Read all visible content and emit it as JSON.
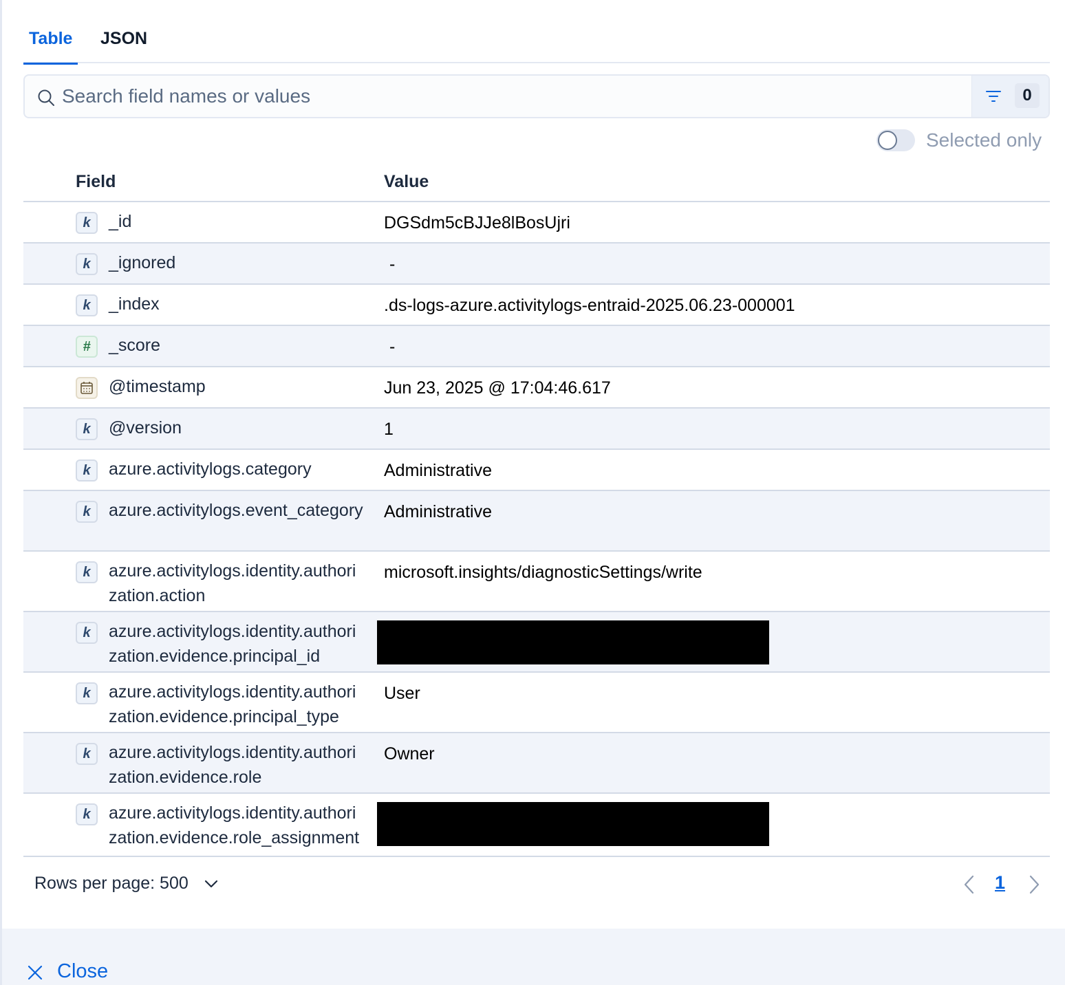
{
  "tabs": [
    {
      "label": "Table",
      "active": true
    },
    {
      "label": "JSON",
      "active": false
    }
  ],
  "search": {
    "placeholder": "Search field names or values",
    "value": "",
    "filter_count": "0"
  },
  "selected_only": {
    "label": "Selected only",
    "checked": false
  },
  "table": {
    "headers": {
      "field": "Field",
      "value": "Value"
    },
    "rows": [
      {
        "type": "k",
        "field": "_id",
        "value": "DGSdm5cBJJe8lBosUjri"
      },
      {
        "type": "k",
        "field": "_ignored",
        "value": "-"
      },
      {
        "type": "k",
        "field": "_index",
        "value": ".ds-logs-azure.activitylogs-entraid-2025.06.23-000001"
      },
      {
        "type": "#",
        "field": "_score",
        "value": "-"
      },
      {
        "type": "date",
        "field": "@timestamp",
        "value": "Jun 23, 2025 @ 17:04:46.617"
      },
      {
        "type": "k",
        "field": "@version",
        "value": "1"
      },
      {
        "type": "k",
        "field": "azure.activitylogs.category",
        "value": "Administrative"
      },
      {
        "type": "k",
        "field": "azure.activitylogs.event_category",
        "value": "Administrative"
      },
      {
        "type": "k",
        "field": "azure.activitylogs.identity.authorization.action",
        "value": "microsoft.insights/diagnosticSettings/write"
      },
      {
        "type": "k",
        "field": "azure.activitylogs.identity.authorization.evidence.principal_id",
        "value": "",
        "redacted": true
      },
      {
        "type": "k",
        "field": "azure.activitylogs.identity.authorization.evidence.principal_type",
        "value": "User"
      },
      {
        "type": "k",
        "field": "azure.activitylogs.identity.authorization.evidence.role",
        "value": "Owner"
      },
      {
        "type": "k",
        "field": "azure.activitylogs.identity.authorization.evidence.role_assignment_id",
        "value": "",
        "redacted": true
      }
    ]
  },
  "pagination": {
    "rows_per_page_label": "Rows per page: 500",
    "current_page": "1"
  },
  "footer": {
    "close_label": "Close"
  },
  "colors": {
    "accent": "#0b64dd",
    "row_alt": "#f1f4fa",
    "border": "#d3dae6"
  }
}
